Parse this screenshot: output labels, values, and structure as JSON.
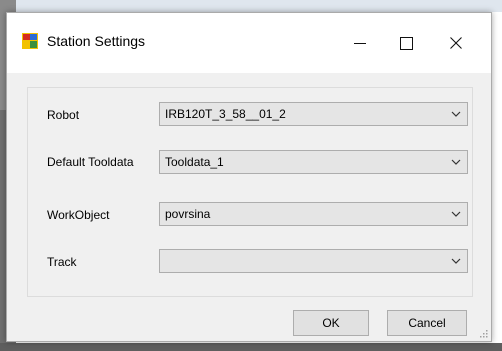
{
  "window": {
    "title": "Station Settings"
  },
  "fields": [
    {
      "label": "Robot",
      "value": "IRB120T_3_58__01_2"
    },
    {
      "label": "Default Tooldata",
      "value": "Tooldata_1"
    },
    {
      "label": "WorkObject",
      "value": "povrsina"
    },
    {
      "label": "Track",
      "value": ""
    }
  ],
  "buttons": {
    "ok": "OK",
    "cancel": "Cancel"
  },
  "icons": {
    "app": "station-settings-icon",
    "minimize": "minimize-icon",
    "maximize": "maximize-icon",
    "close": "close-icon",
    "dropdown": "chevron-down-icon",
    "grip": "resize-grip-icon"
  },
  "colors": {
    "dialog_bg": "#f0f0f0",
    "titlebar_bg": "#ffffff",
    "combo_bg": "#e5e5e5",
    "button_bg": "#e1e1e1"
  }
}
